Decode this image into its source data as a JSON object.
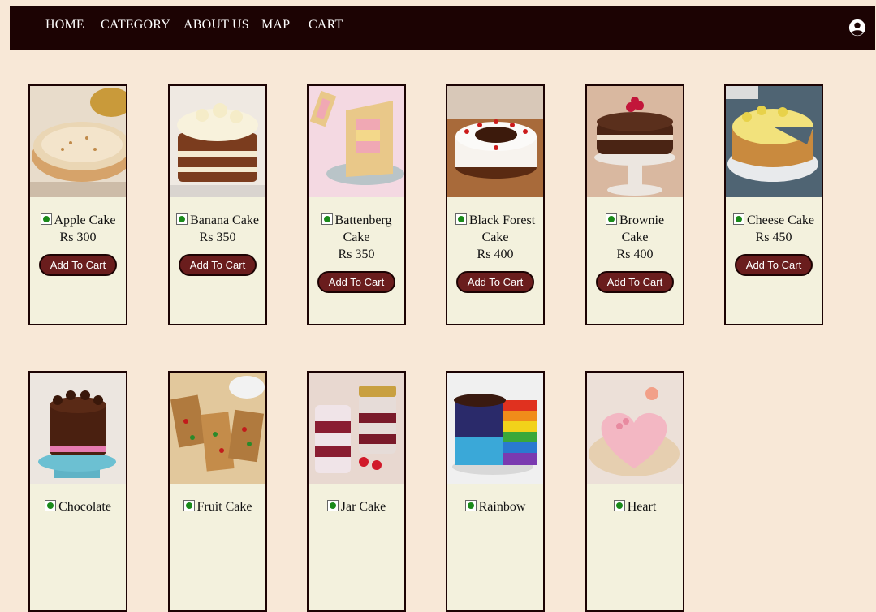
{
  "nav": {
    "links": [
      "HOME",
      "CATEGORY",
      "ABOUT US",
      "MAP",
      "CART"
    ],
    "profile_icon": "user-circle-icon"
  },
  "products": [
    {
      "name": "Apple Cake",
      "price": "Rs 300",
      "button": "Add To Cart"
    },
    {
      "name": "Banana Cake",
      "price": "Rs 350",
      "button": "Add To Cart"
    },
    {
      "name": "Battenberg Cake",
      "price": "Rs 350",
      "button": "Add To Cart"
    },
    {
      "name": "Black Forest Cake",
      "price": "Rs 400",
      "button": "Add To Cart"
    },
    {
      "name": "Brownie Cake",
      "price": "Rs 400",
      "button": "Add To Cart"
    },
    {
      "name": "Cheese Cake",
      "price": "Rs 450",
      "button": "Add To Cart"
    },
    {
      "name": "Chocolate",
      "price": "",
      "button": ""
    },
    {
      "name": "Fruit Cake",
      "price": "",
      "button": ""
    },
    {
      "name": "Jar Cake",
      "price": "",
      "button": ""
    },
    {
      "name": "Rainbow",
      "price": "",
      "button": ""
    },
    {
      "name": "Heart",
      "price": "",
      "button": ""
    }
  ],
  "colors": {
    "nav_bg": "#1c0303",
    "page_bg": "#f8e8d7",
    "card_bg": "#f3f1dd",
    "button_bg": "#6a1d1d",
    "veg_dot": "#1a8a1a"
  }
}
